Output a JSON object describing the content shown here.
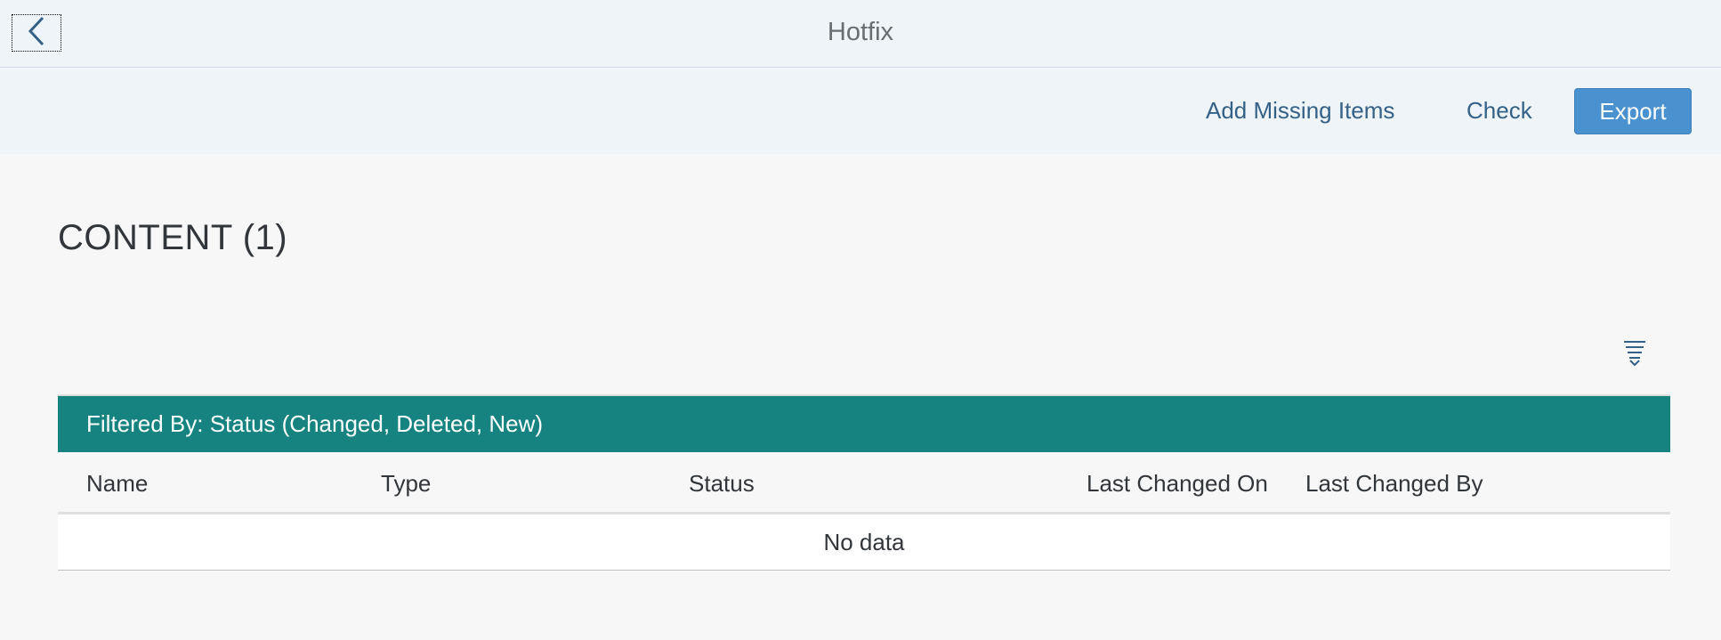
{
  "header": {
    "title": "Hotfix",
    "back_icon": "chevron-left-icon"
  },
  "toolbar": {
    "add_missing_label": "Add Missing Items",
    "check_label": "Check",
    "export_label": "Export"
  },
  "content": {
    "title": "CONTENT (1)",
    "settings_icon": "table-settings-icon"
  },
  "table": {
    "filter_text": "Filtered By: Status (Changed, Deleted, New)",
    "columns": [
      "Name",
      "Type",
      "Status",
      "Last Changed On",
      "Last Changed By"
    ],
    "no_data_text": "No data"
  },
  "colors": {
    "header_bg": "#eff4f9",
    "filter_bar_bg": "#178380",
    "export_bg": "#4a91d0",
    "link_color": "#346187"
  }
}
